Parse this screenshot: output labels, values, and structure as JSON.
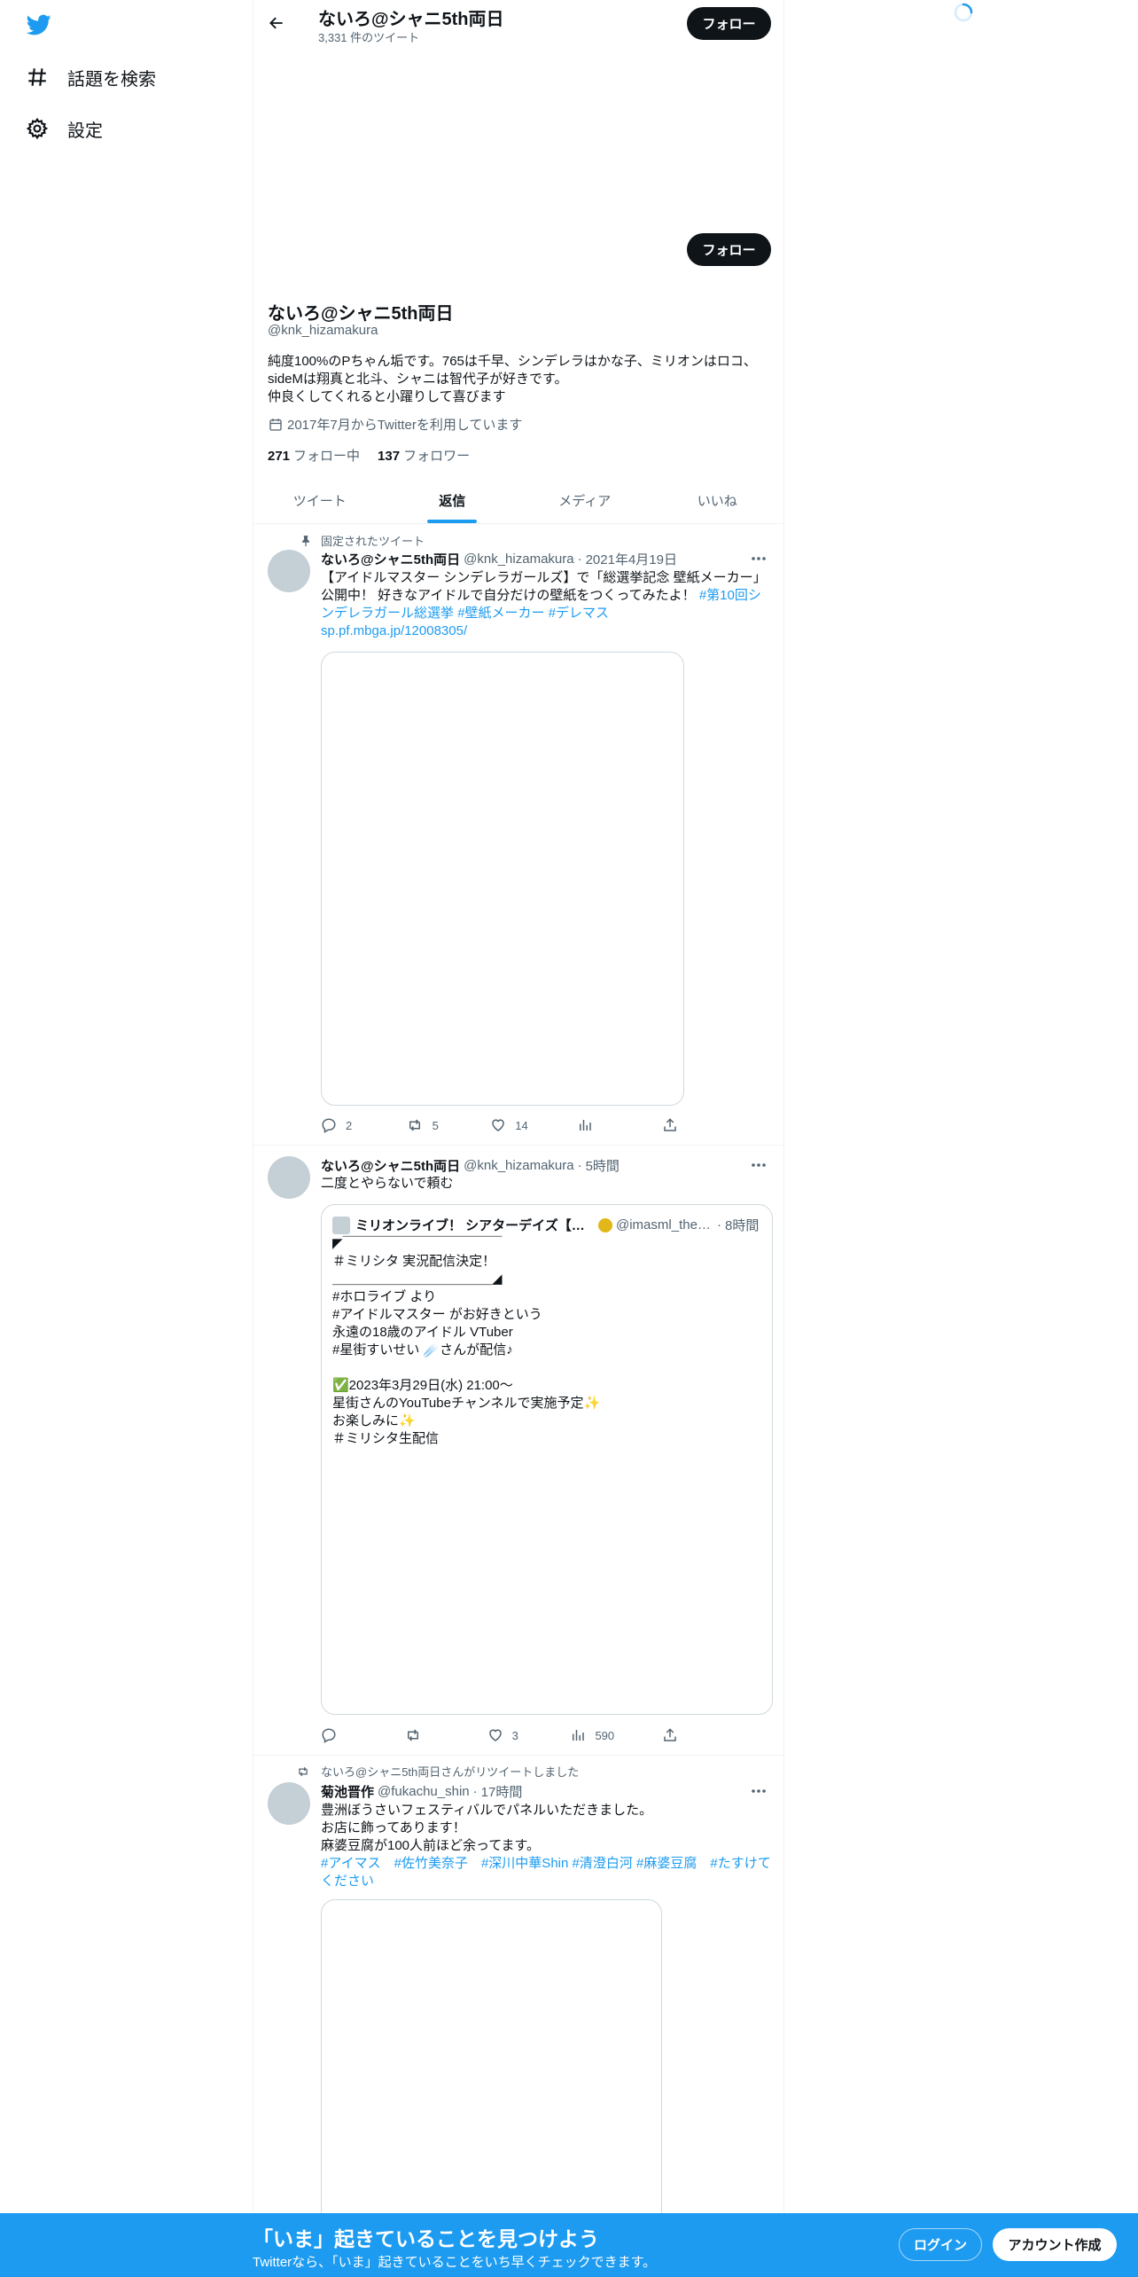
{
  "nav": {
    "logo": "twitter-bird-icon",
    "explore_label": "話題を検索",
    "settings_label": "設定"
  },
  "header": {
    "name": "ないろ@シャニ5th両日",
    "tweet_count": "3,331 件のツイート",
    "follow_label": "フォロー"
  },
  "profile": {
    "name": "ないろ@シャニ5th両日",
    "handle": "@knk_hizamakura",
    "bio": "純度100%のPちゃん垢です。765は千早、シンデレラはかな子、ミリオンはロコ、sideMは翔真と北斗、シャニは智代子が好きです。\n仲良くしてくれると小躍りして喜びます",
    "joined": "2017年7月からTwitterを利用しています",
    "following_count": "271",
    "following_label": "フォロー中",
    "followers_count": "137",
    "followers_label": "フォロワー",
    "follow_label": "フォロー"
  },
  "tabs": [
    {
      "label": "ツイート"
    },
    {
      "label": "返信"
    },
    {
      "label": "メディア"
    },
    {
      "label": "いいね"
    }
  ],
  "tweets": [
    {
      "context": "固定されたツイート",
      "name": "ないろ@シャニ5th両日",
      "handle": "@knk_hizamakura",
      "dot": "·",
      "time": "2021年4月19日",
      "text": "【アイドルマスター シンデレラガールズ】で「総選挙記念 壁紙メーカー」公開中！ 好きなアイドルで自分だけの壁紙をつくってみたよ！ ",
      "links": [
        "#第10回シンデレラガール総選挙",
        "#壁紙メーカー",
        "#デレマス",
        "sp.pf.mbga.jp/12008305/"
      ],
      "replies": "2",
      "retweets": "5",
      "likes": "14"
    },
    {
      "name": "ないろ@シャニ5th両日",
      "handle": "@knk_hizamakura",
      "dot": "·",
      "time": "5時間",
      "text": "二度とやらないで頼む",
      "quote": {
        "name": "ミリオンライブ！ シアターデイズ【公式】",
        "handle": "@imasml_theater",
        "dot": "·",
        "time": "8時間",
        "text": "◤￣￣￣￣￣￣￣￣￣￣￣￣\n＃ミリシタ 実況配信決定！\n＿＿＿＿＿＿＿＿＿＿＿＿◢\n#ホロライブ より\n#アイドルマスター がお好きという\n永遠の18歳のアイドル VTuber\n#星街すいせい ☄️さんが配信♪\n\n✅2023年3月29日(水) 21:00～\n星街さんのYouTubeチャンネルで実施予定✨\nお楽しみに✨\n＃ミリシタ生配信"
      },
      "likes": "3",
      "views": "590"
    },
    {
      "context": "ないろ@シャニ5th両日さんがリツイートしました",
      "name": "菊池晋作",
      "handle": "@fukachu_shin",
      "dot": "·",
      "time": "17時間",
      "text": "豊洲ぼうさいフェスティバルでパネルいただきました。\nお店に飾ってあります！\n麻婆豆腐が100人前ほど余ってます。\n",
      "links": [
        "#アイマス",
        "#佐竹美奈子",
        "#深川中華Shin",
        "#清澄白河",
        "#麻婆豆腐",
        "#たすけてください"
      ]
    }
  ],
  "bottom_bar": {
    "title": "「いま」起きていることを見つけよう",
    "subtitle": "Twitterなら、「いま」起きていることをいち早くチェックできます。",
    "login_label": "ログイン",
    "signup_label": "アカウント作成"
  },
  "colors": {
    "accent": "#1d9bf0",
    "text": "#0f1419",
    "muted": "#536471"
  }
}
